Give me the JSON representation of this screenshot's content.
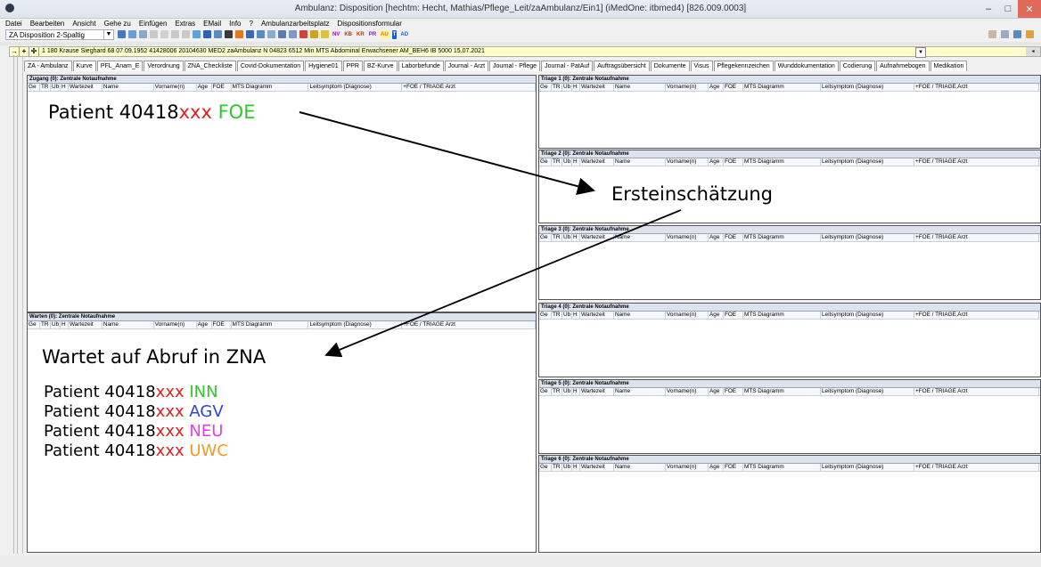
{
  "window": {
    "title": "Ambulanz: Disposition [hechtm: Hecht, Mathias/Pflege_Leit/zaAmbulanz/Ein1] (iMedOne: itbmed4) [826.009.0003]",
    "min": "–",
    "max": "□",
    "close": "✕"
  },
  "menu": [
    "Datei",
    "Bearbeiten",
    "Ansicht",
    "Gehe zu",
    "Einfügen",
    "Extras",
    "EMail",
    "Info",
    "?",
    "Ambulanzarbeitsplatz",
    "Dispositionsformular"
  ],
  "toolbar": {
    "view_select": "ZA Disposition 2-Spaltig",
    "tags": [
      {
        "label": "NV",
        "color": "#b000b0"
      },
      {
        "label": "KB",
        "color": "#d03000"
      },
      {
        "label": "KR",
        "color": "#d03000"
      },
      {
        "label": "PR",
        "color": "#7030a0"
      },
      {
        "label": "AU",
        "color": "#c08000"
      },
      {
        "label": "T",
        "color": "#1a5fd0"
      },
      {
        "label": "AD",
        "color": "#1a5fd0"
      }
    ]
  },
  "patient_bar": {
    "text": "1 180 Krause Sieghard 68 07.09.1952 41428006 20104630 MED2 zaAmbulanz N 04823 6512 Min MTS Abdominal Erwachsener AM_BEH6 IB 5000 15.07.2021"
  },
  "tabs": [
    "ZA - Ambulanz",
    "Kurve",
    "PFL_Anam_E",
    "Verordnung",
    "ZNA_Checkliste",
    "Covid-Dokumentation",
    "Hygiene01",
    "PPR",
    "BZ-Kurve",
    "Laborbefunde",
    "Journal - Arzt",
    "Journal - Pflege",
    "Journal - PatAuf",
    "Auftragsübersicht",
    "Dokumente",
    "Visus",
    "Pflegekennzeichen",
    "Wunddokumentation",
    "Codierung",
    "Aufnahmebogen",
    "Medikation"
  ],
  "columns": [
    "Ge",
    "TR",
    "Üb",
    "H",
    "Wartezeit",
    "Name",
    "Vorname(n)",
    "Age",
    "FOE",
    "MTS Diagramm",
    "Leitsymptom (Diagnose)",
    "+FOE / TRIAGE Arzt"
  ],
  "panes": {
    "zugang": "Zugang (0): Zentrale Notaufnahme",
    "warten": "Warten (0): Zentrale Notaufnahme",
    "triage": [
      "Triage 1 (0): Zentrale Notaufnahme",
      "Triage 2 (0): Zentrale Notaufnahme",
      "Triage 3 (0): Zentrale Notaufnahme",
      "Triage 4 (0): Zentrale Notaufnahme",
      "Triage 5 (0): Zentrale Notaufnahme",
      "Triage 6 (0): Zentrale Notaufnahme"
    ]
  },
  "annotations": {
    "top_patient": {
      "prefix": "Patient 40418",
      "mask": "xxx",
      "code": "FOE",
      "code_color": "#2dc82d"
    },
    "ersteinschaetzung": "Ersteinschätzung",
    "wartet": "Wartet auf Abruf in ZNA",
    "waiting_patients": [
      {
        "prefix": "Patient 40418",
        "mask": "xxx",
        "code": "INN",
        "code_color": "#2dc82d"
      },
      {
        "prefix": "Patient 40418",
        "mask": "xxx",
        "code": "AGV",
        "code_color": "#2f40e0"
      },
      {
        "prefix": "Patient 40418",
        "mask": "xxx",
        "code": "NEU",
        "code_color": "#e040e0"
      },
      {
        "prefix": "Patient 40418",
        "mask": "xxx",
        "code": "UWC",
        "code_color": "#f29a1e"
      }
    ]
  }
}
